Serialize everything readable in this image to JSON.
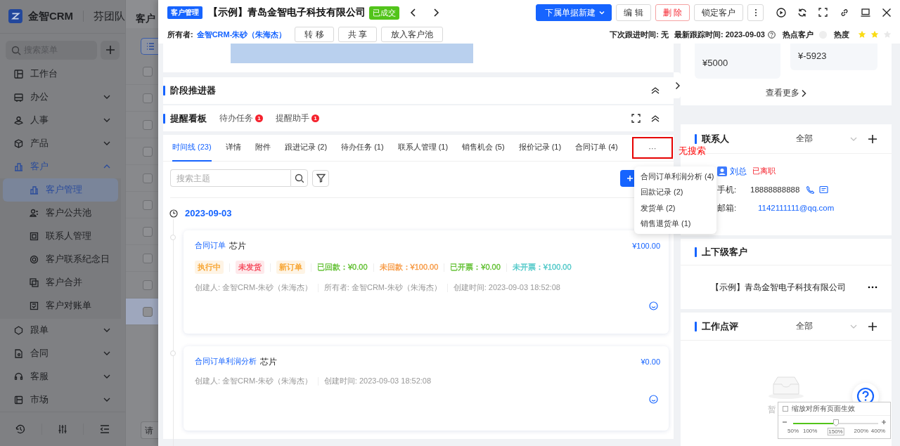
{
  "sidebar": {
    "brand": "金智CRM",
    "team": "芬团队",
    "search": {
      "placeholder": "搜索菜单"
    },
    "items": [
      {
        "label": "工作台",
        "kind": "link",
        "selected": false
      },
      {
        "label": "办公",
        "kind": "group",
        "selected": false,
        "expanded": false
      },
      {
        "label": "人事",
        "kind": "group",
        "selected": false,
        "expanded": false
      },
      {
        "label": "产品",
        "kind": "group",
        "selected": false,
        "expanded": false
      },
      {
        "label": "客户",
        "kind": "group",
        "selected": true,
        "expanded": true,
        "children": [
          {
            "label": "客户管理",
            "selected": true
          },
          {
            "label": "客户公共池",
            "selected": false
          },
          {
            "label": "联系人管理",
            "selected": false
          },
          {
            "label": "客户联系纪念日",
            "selected": false
          },
          {
            "label": "客户合并",
            "selected": false
          },
          {
            "label": "客户对账单",
            "selected": false
          }
        ]
      },
      {
        "label": "跟单",
        "kind": "group",
        "selected": false,
        "expanded": false
      },
      {
        "label": "合同",
        "kind": "group",
        "selected": false,
        "expanded": false
      },
      {
        "label": "客服",
        "kind": "group",
        "selected": false,
        "expanded": false
      },
      {
        "label": "市场",
        "kind": "group",
        "selected": false,
        "expanded": false
      }
    ]
  },
  "list_page": {
    "title": "客户",
    "rows": [
      {
        "checked": false,
        "selected": false
      },
      {
        "checked": false,
        "selected": false
      },
      {
        "checked": false,
        "selected": false
      },
      {
        "checked": false,
        "selected": false
      },
      {
        "checked": false,
        "selected": false
      },
      {
        "checked": false,
        "selected": false
      },
      {
        "checked": false,
        "selected": false
      },
      {
        "checked": false,
        "selected": false
      },
      {
        "checked": false,
        "selected": false
      },
      {
        "checked": false,
        "selected": true
      }
    ],
    "filter": {
      "placeholder": "请"
    }
  },
  "header": {
    "module_tag": "客户管理",
    "title": "【示例】青岛金智电子科技有限公司",
    "status_tag": "已成交",
    "actions": [
      {
        "label": "下属单据新建",
        "kind": "primary"
      },
      {
        "label": "编 辑",
        "kind": "default"
      },
      {
        "label": "删 除",
        "kind": "danger"
      },
      {
        "label": "锁定客户",
        "kind": "default"
      }
    ],
    "owner_label": "所有者:",
    "owner": "金智CRM-朱砂（朱海杰）",
    "owner_actions": [
      "转 移",
      "共 享",
      "放入客户池"
    ],
    "next_follow": "下次跟进时间: 无",
    "last_follow": "最新跟踪时间: 2023-09-03",
    "hot_customer": {
      "label": "热点客户",
      "on": false
    },
    "heat": {
      "label": "热度",
      "stars": 2
    }
  },
  "stage": {
    "title": "阶段推进器"
  },
  "reminders": {
    "title": "提醒看板",
    "items": [
      {
        "label": "待办任务",
        "count": "1"
      },
      {
        "label": "提醒助手",
        "count": "1"
      }
    ]
  },
  "tabs": [
    {
      "label": "时间线 (23)",
      "selected": true
    },
    {
      "label": "详情",
      "selected": false
    },
    {
      "label": "附件",
      "selected": false
    },
    {
      "label": "跟进记录 (2)",
      "selected": false
    },
    {
      "label": "待办任务 (1)",
      "selected": false
    },
    {
      "label": "联系人管理 (1)",
      "selected": false
    },
    {
      "label": "销售机会 (5)",
      "selected": false
    },
    {
      "label": "报价记录 (1)",
      "selected": false
    },
    {
      "label": "合同订单 (4)",
      "selected": false
    }
  ],
  "more_tabs": "···",
  "annotation": "无搜索",
  "more_menu": [
    "合同订单利润分析 (4)",
    "回款记录 (2)",
    "发货单 (2)",
    "销售退货单 (1)"
  ],
  "timeline": {
    "search": {
      "placeholder": "搜索主题"
    },
    "date": "2023-09-03",
    "entries": [
      {
        "type_label": "合同订单",
        "name": "芯片",
        "amount": "¥100.00",
        "tags": [
          {
            "text": "执行中",
            "color": "#f7a22c"
          },
          {
            "text": "未发货",
            "color": "#f5475a"
          },
          {
            "text": "新订单",
            "color": "#f7a22c"
          }
        ],
        "figures": [
          {
            "text": "已回款：¥0.00",
            "color": "#5fbf2f"
          },
          {
            "text": "未回款：¥100.00",
            "color": "#f79a45"
          },
          {
            "text": "已开票：¥0.00",
            "color": "#5fbf2f"
          },
          {
            "text": "未开票：¥100.00",
            "color": "#4fc8c8"
          }
        ],
        "meta": [
          "创建人: 金智CRM-朱砂（朱海杰）",
          "所有者: 金智CRM-朱砂（朱海杰）",
          "创建时间: 2023-09-03 18:52:08"
        ]
      },
      {
        "type_label": "合同订单利润分析",
        "name": "芯片",
        "amount": "¥0.00",
        "meta": [
          "创建人: 金智CRM-朱砂（朱海杰）",
          "创建时间: 2023-09-03 18:52:08"
        ]
      }
    ]
  },
  "right": {
    "stats": [
      "¥5000",
      "¥-5923"
    ],
    "more": "查看更多",
    "contacts": {
      "title": "联系人",
      "filter": "全部",
      "name": "刘总",
      "status": "已离职",
      "phone_label": "手机:",
      "phone": "18888888888",
      "email_label": "邮箱:",
      "email": "1142111111@qq.com"
    },
    "relations": {
      "title": "上下级客户",
      "items": [
        "【示例】青岛金智电子科技有限公司"
      ]
    },
    "reviews": {
      "title": "工作点评",
      "filter": "全部",
      "empty": "暂"
    }
  },
  "zoom": {
    "apply_all": {
      "label": "缩放对所有页面生效",
      "checked": false
    },
    "level": 0.5,
    "ticks": [
      "50%",
      "100%",
      "150%",
      "200%",
      "400%"
    ]
  }
}
